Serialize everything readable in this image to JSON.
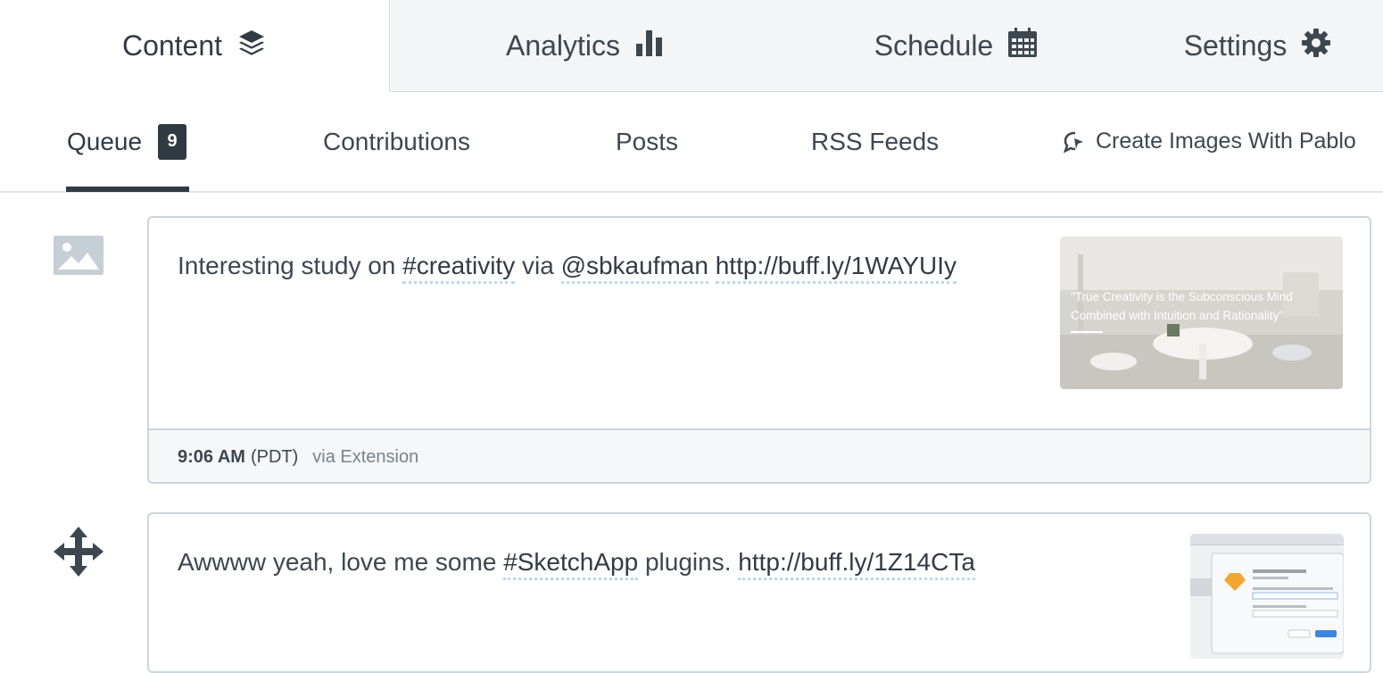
{
  "top_tabs": {
    "content": {
      "label": "Content",
      "icon": "layers-icon"
    },
    "analytics": {
      "label": "Analytics",
      "icon": "bar-chart-icon"
    },
    "schedule": {
      "label": "Schedule",
      "icon": "calendar-icon"
    },
    "settings": {
      "label": "Settings",
      "icon": "gear-icon"
    }
  },
  "sub_tabs": {
    "queue": {
      "label": "Queue",
      "count": "9"
    },
    "contributions": {
      "label": "Contributions"
    },
    "posts": {
      "label": "Posts"
    },
    "rss": {
      "label": "RSS Feeds"
    },
    "pablo": {
      "label": "Create Images With Pablo",
      "icon": "pablo-icon"
    }
  },
  "posts": [
    {
      "side_icon": "image-icon",
      "text_before": "Interesting study on ",
      "hashtag": "#creativity",
      "text_mid": " via ",
      "mention": "@sbkaufman",
      "text_space": " ",
      "url": "http://buff.ly/1WAYUIy",
      "thumbnail_caption": "\"True Creativity is the Subconscious Mind Combined with Intuition and Rationality\"",
      "time": "9:06 AM",
      "timezone": "(PDT)",
      "via": "via Extension"
    },
    {
      "side_icon": "move-icon",
      "text_before": "Awwww yeah, love me some ",
      "hashtag": "#SketchApp",
      "text_mid": " plugins. ",
      "url": "http://buff.ly/1Z14CTa"
    }
  ],
  "colors": {
    "text": "#323b43",
    "border": "#ccd5dc",
    "tab_bg": "#f3f5f7",
    "link_underline": "#b9d9ee"
  }
}
